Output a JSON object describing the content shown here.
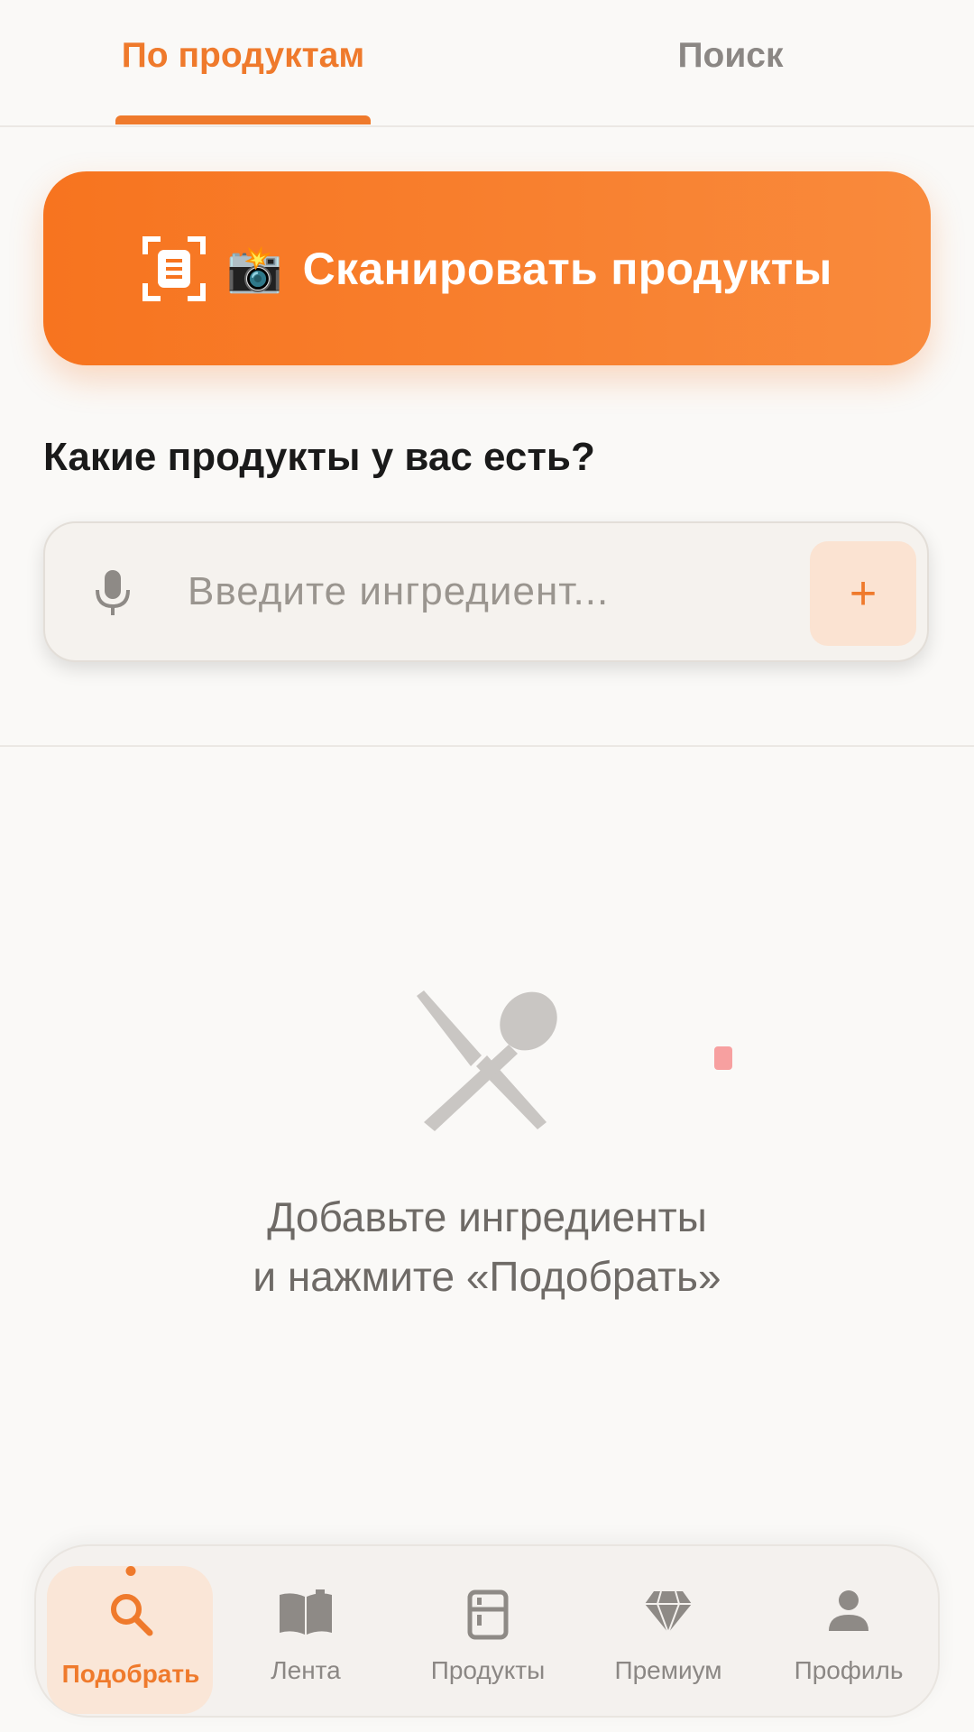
{
  "tabs": {
    "active": "По продуктам",
    "inactive": "Поиск"
  },
  "scan_button": {
    "emoji": "📸",
    "label": "Сканировать продукты"
  },
  "question": "Какие продукты у вас есть?",
  "input": {
    "placeholder": "Введите ингредиент...",
    "add_label": "+"
  },
  "empty_state": {
    "line1": "Добавьте ингредиенты",
    "line2": "и нажмите «Подобрать»"
  },
  "bottom_nav": {
    "items": [
      {
        "label": "Подобрать",
        "icon": "search-icon",
        "active": true
      },
      {
        "label": "Лента",
        "icon": "book-icon"
      },
      {
        "label": "Продукты",
        "icon": "fridge-icon"
      },
      {
        "label": "Премиум",
        "icon": "diamond-icon"
      },
      {
        "label": "Профиль",
        "icon": "person-icon"
      }
    ]
  },
  "colors": {
    "accent": "#ef7a2c",
    "background": "#faf9f7",
    "muted": "#8b8784"
  }
}
